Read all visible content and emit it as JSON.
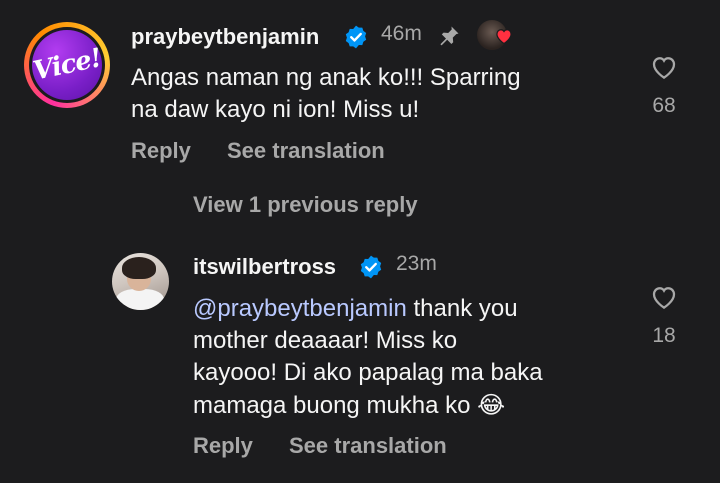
{
  "comment": {
    "username": "praybeytbenjamin",
    "time": "46m",
    "text_lines": [
      "Angas naman ng anak ko!!! Sparring",
      "na daw kayo ni ion! Miss u!"
    ],
    "like_count": "68",
    "reply_label": "Reply",
    "see_translation_label": "See translation",
    "avatar_logo_text": "Vice!"
  },
  "view_replies_label": "View 1 previous reply",
  "reply": {
    "username": "itswilbertross",
    "time": "23m",
    "mention": "@praybeytbenjamin",
    "text_line1_rest": " thank you",
    "text_lines": [
      "mother deaaaar! Miss ko",
      "kayooo! Di ako papalag ma baka",
      "mamaga buong mukha ko"
    ],
    "emoji": "😂",
    "like_count": "18",
    "reply_label": "Reply",
    "see_translation_label": "See translation"
  },
  "icons": {
    "verified": "verified-badge-icon",
    "pin": "pin-icon",
    "heart": "heart-outline-icon",
    "liked_by_author": "heart-filled-icon"
  },
  "colors": {
    "background": "#1c1c1e",
    "primary_text": "#f5f5f5",
    "secondary_text": "#a8a8a8",
    "verified_blue": "#0095f6",
    "mention": "#b9c9ff",
    "heart_red": "#ff3040"
  }
}
